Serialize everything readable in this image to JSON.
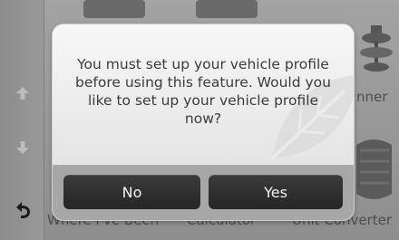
{
  "background": {
    "items": [
      {
        "label": "Where I've Been"
      },
      {
        "label": "Calculator"
      },
      {
        "label": "Unit Converter"
      },
      {
        "label": "Trip Planner",
        "visible_fragment": "nner"
      }
    ]
  },
  "rail": {
    "up_icon": "arrow-up-icon",
    "down_icon": "arrow-down-icon",
    "back_icon": "back-arrow-icon"
  },
  "dialog": {
    "message_lines": [
      "You must set up your vehicle profile",
      "before using this feature. Would you",
      "like to set up your vehicle profile",
      "now?"
    ],
    "no_label": "No",
    "yes_label": "Yes"
  },
  "colors": {
    "dialog_bg": "#eeeeee",
    "button_bg": "#2e2e2e",
    "footer_bg": "#a7a7a7"
  }
}
